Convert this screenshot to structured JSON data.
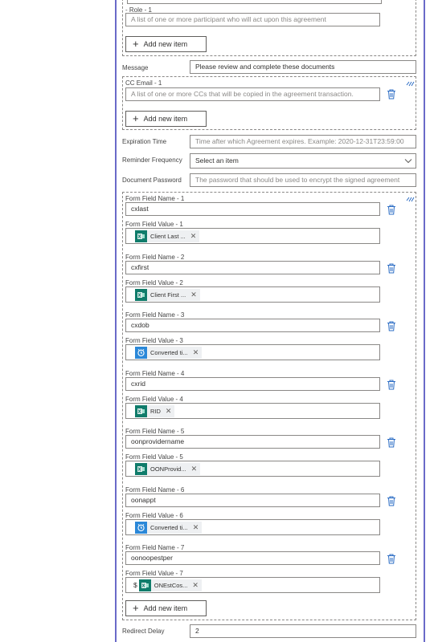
{
  "participants": {
    "role_label": "- Role - 1",
    "participant_placeholder": "A list of one or more participant who will act upon this agreement",
    "add_item_label": "Add new item"
  },
  "message": {
    "label": "Message",
    "value": "Please review and complete these documents"
  },
  "cc": {
    "label": "CC Email - 1",
    "placeholder": "A list of one or more CCs that will be copied in the agreement transaction.",
    "add_item_label": "Add new item"
  },
  "expiration": {
    "label": "Expiration Time",
    "placeholder": "Time after which Agreement expires. Example: 2020-12-31T23:59:00"
  },
  "reminder": {
    "label": "Reminder Frequency",
    "value": "Select an item"
  },
  "password": {
    "label": "Document Password",
    "placeholder": "The password that should be used to encrypt the signed agreement"
  },
  "form_fields": [
    {
      "name_label": "Form Field Name - 1",
      "name_value": "cxlast",
      "value_label": "Form Field Value - 1",
      "prefix": "",
      "chip_text": "Client Last ...",
      "chip_type": "excel"
    },
    {
      "name_label": "Form Field Name - 2",
      "name_value": "cxfirst",
      "value_label": "Form Field Value - 2",
      "prefix": "",
      "chip_text": "Client First ...",
      "chip_type": "excel"
    },
    {
      "name_label": "Form Field Name - 3",
      "name_value": "cxdob",
      "value_label": "Form Field Value - 3",
      "prefix": "",
      "chip_text": "Converted ti...",
      "chip_type": "clock"
    },
    {
      "name_label": "Form Field Name - 4",
      "name_value": "cxrid",
      "value_label": "Form Field Value - 4",
      "prefix": "",
      "chip_text": "RID",
      "chip_type": "excel"
    },
    {
      "name_label": "Form Field Name - 5",
      "name_value": "oonprovidername",
      "value_label": "Form Field Value - 5",
      "prefix": "",
      "chip_text": "OONProvid...",
      "chip_type": "excel"
    },
    {
      "name_label": "Form Field Name - 6",
      "name_value": "oonappt",
      "value_label": "Form Field Value - 6",
      "prefix": "",
      "chip_text": "Converted ti...",
      "chip_type": "clock"
    },
    {
      "name_label": "Form Field Name - 7",
      "name_value": "oonoopestper",
      "value_label": "Form Field Value - 7",
      "prefix": "$",
      "chip_text": "ONEstCos...",
      "chip_type": "excel"
    }
  ],
  "form_add_item_label": "Add new item",
  "redirect": {
    "label": "Redirect Delay",
    "value": "2"
  },
  "colors": {
    "excel": "#107c6b",
    "clock": "#2b88d8",
    "accent": "#6a6ac8",
    "trash": "#2b6cc4"
  }
}
